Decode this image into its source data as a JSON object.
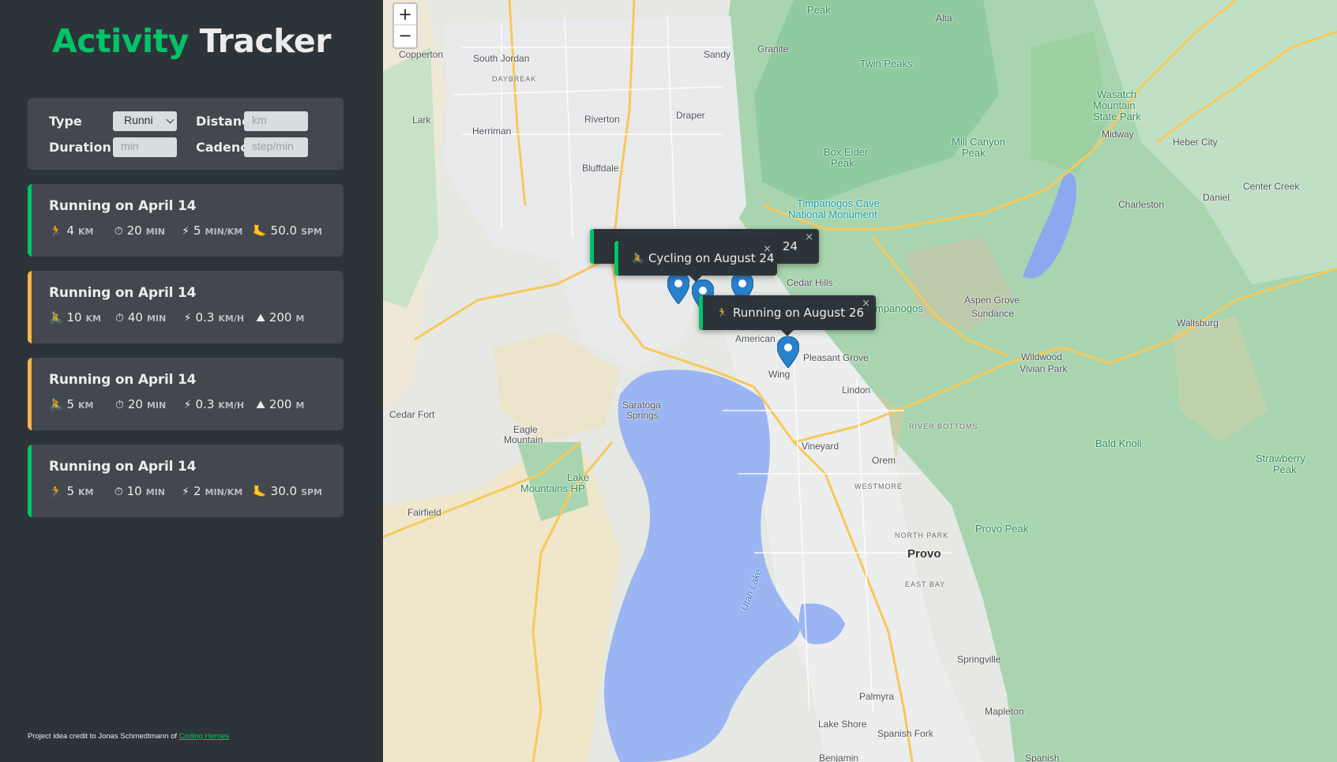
{
  "app": {
    "title_brand": "Activity",
    "title_rest": "Tracker"
  },
  "form": {
    "type_label": "Type",
    "type_value": "Runni",
    "distance_label": "Distance",
    "distance_placeholder": "km",
    "duration_label": "Duration",
    "duration_placeholder": "min",
    "cadence_label": "Cadence",
    "cadence_placeholder": "step/min"
  },
  "workouts": [
    {
      "title": "Running on April 14",
      "accent": "#00c46a",
      "d1_icon": "running-icon",
      "d1_val": "4",
      "d1_unit": "KM",
      "d2_val": "20",
      "d2_unit": "MIN",
      "d3_val": "5",
      "d3_unit": "MIN/KM",
      "d4_icon": "footprint-icon",
      "d4_val": "50.0",
      "d4_unit": "SPM"
    },
    {
      "title": "Running on April 14",
      "accent": "#ffb545",
      "d1_icon": "cycling-icon",
      "d1_val": "10",
      "d1_unit": "KM",
      "d2_val": "40",
      "d2_unit": "MIN",
      "d3_val": "0.3",
      "d3_unit": "KM/H",
      "d4_icon": "mountain-icon",
      "d4_val": "200",
      "d4_unit": "M"
    },
    {
      "title": "Running on April 14",
      "accent": "#ffb545",
      "d1_icon": "cycling-icon",
      "d1_val": "5",
      "d1_unit": "KM",
      "d2_val": "20",
      "d2_unit": "MIN",
      "d3_val": "0.3",
      "d3_unit": "KM/H",
      "d4_icon": "mountain-icon",
      "d4_val": "200",
      "d4_unit": "M"
    },
    {
      "title": "Running on April 14",
      "accent": "#00c46a",
      "d1_icon": "running-icon",
      "d1_val": "5",
      "d1_unit": "KM",
      "d2_val": "10",
      "d2_unit": "MIN",
      "d3_val": "2",
      "d3_unit": "MIN/KM",
      "d4_icon": "footprint-icon",
      "d4_val": "30.0",
      "d4_unit": "SPM"
    }
  ],
  "credit": {
    "text": "Project idea credit to Jonas Schmedtmann of",
    "link": "Coding Heroes"
  },
  "map": {
    "zoom_in": "+",
    "zoom_out": "−",
    "popups": [
      {
        "text": "24",
        "close": "×"
      },
      {
        "text": "Cycling on August 24",
        "close": "×"
      },
      {
        "text": "Running on August 26",
        "close": "×"
      }
    ],
    "labels": {
      "copperton": "Copperton",
      "south_jordan": "South Jordan",
      "sandy": "Sandy",
      "granite": "Granite",
      "daybreak": "DAYBREAK",
      "lark": "Lark",
      "herriman": "Herriman",
      "riverton": "Riverton",
      "draper": "Draper",
      "bluffdale": "Bluffdale",
      "alta": "Alta",
      "twin_peaks": "Twin Peaks",
      "osullivan_peak": "Peak",
      "wasatch": "Wasatch",
      "wasatch2": "Mountain",
      "wasatch3": "State Park",
      "midway": "Midway",
      "heber_city": "Heber City",
      "mill_canyon": "Mill Canyon",
      "mill_canyon2": "Peak",
      "box_elder": "Box Elder",
      "box_elder2": "Peak",
      "timp_cave": "Timpanogos Cave",
      "timp_cave2": "National Monument",
      "center_creek": "Center Creek",
      "charleston": "Charleston",
      "daniel": "Daniel",
      "cedar_hills": "Cedar Hills",
      "timpanogos": "mpanogos",
      "aspen_grove": "Aspen Grove",
      "sundance": "Sundance",
      "wallsburg": "Wallsburg",
      "american": "American",
      "pleasant_grove": "Pleasant Grove",
      "wing": "Wing",
      "wildwood": "Wildwood",
      "vivian_park": "Vivian Park",
      "lindon": "Lindon",
      "cedar_fort": "Cedar Fort",
      "saratoga": "Saratoga",
      "saratoga2": "Springs",
      "eagle_mountain": "Eagle",
      "eagle_mountain2": "Mountain",
      "river_bottoms": "RIVER BOTTOMS",
      "bald_knoll": "Bald Knoll",
      "vineyard": "Vineyard",
      "orem": "Orem",
      "westmore": "WESTMORE",
      "strawberry": "Strawberry",
      "strawberry2": "Peak",
      "lake_mountains": "Lake",
      "lake_mountains2": "Mountains HP",
      "fairfield": "Fairfield",
      "provo_peak": "Provo Peak",
      "north_park": "NORTH PARK",
      "provo": "Provo",
      "east_bay": "EAST BAY",
      "utah_lake": "Utah Lake",
      "springville": "Springville",
      "palmyra": "Palmyra",
      "mapleton": "Mapleton",
      "lake_shore": "Lake Shore",
      "spanish_fork": "Spanish Fork",
      "benjamin": "Benjamin",
      "spanish": "Spanish"
    }
  }
}
